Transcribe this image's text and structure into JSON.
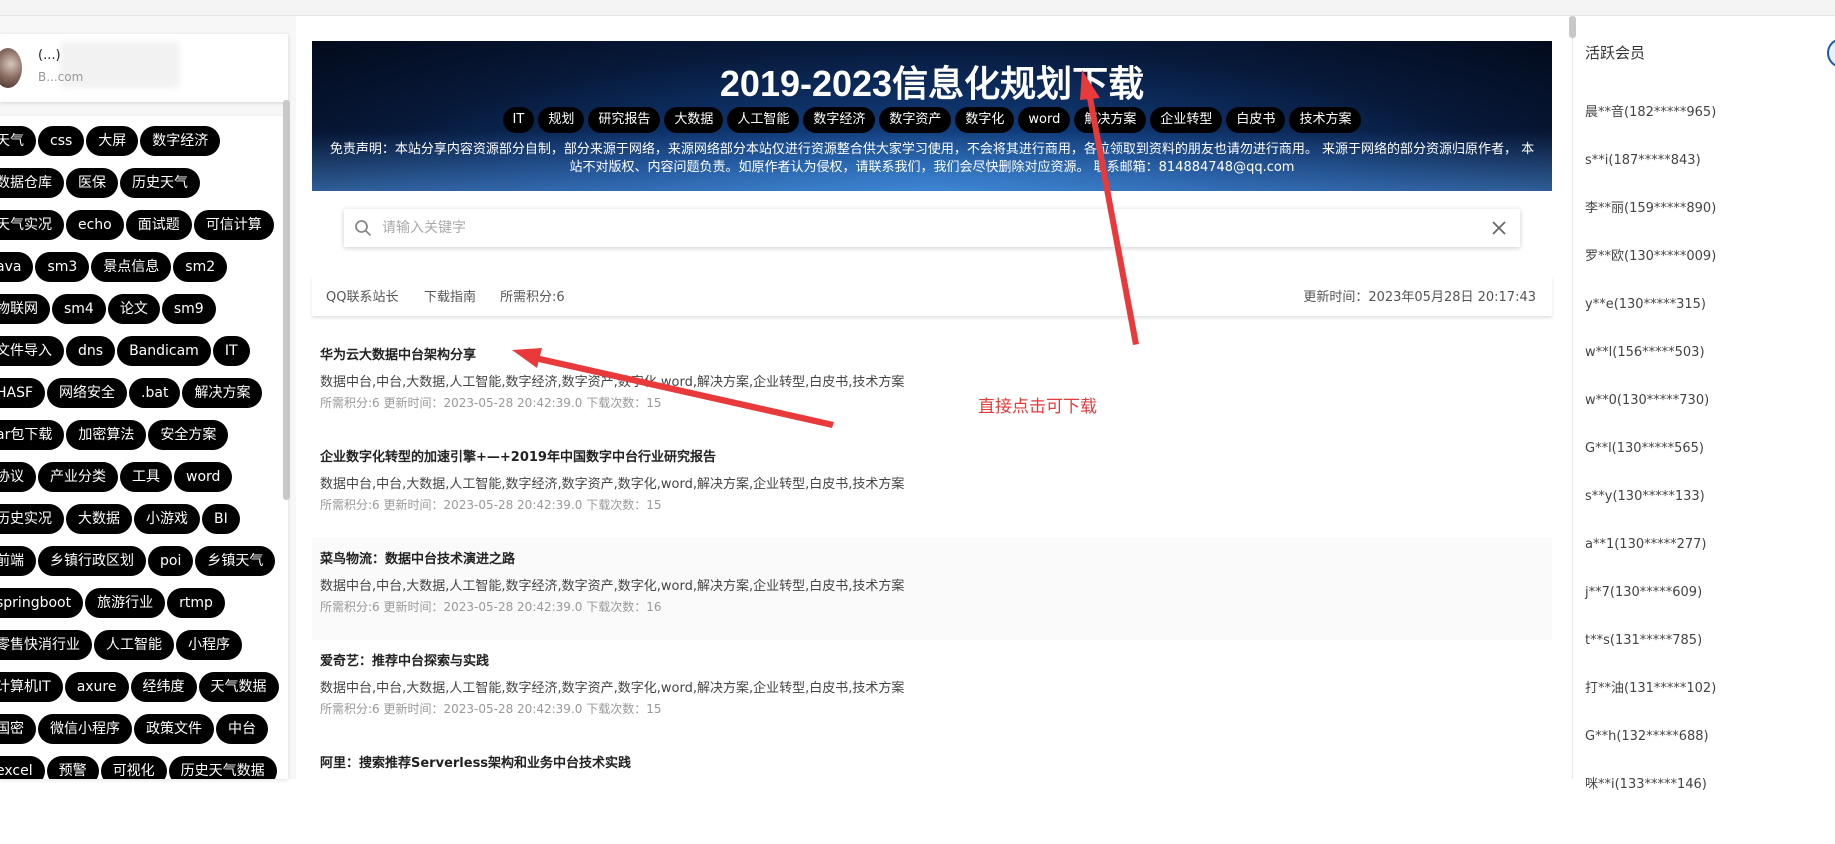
{
  "user": {
    "name": "(...)",
    "sub": "B...com"
  },
  "left_tags": [
    [
      "天气",
      "css",
      "大屏",
      "数字经济"
    ],
    [
      "数据仓库",
      "医保",
      "历史天气"
    ],
    [
      "天气实况",
      "echo",
      "面试题",
      "可信计算"
    ],
    [
      "ava",
      "sm3",
      "景点信息",
      "sm2"
    ],
    [
      "物联网",
      "sm4",
      "论文",
      "sm9"
    ],
    [
      "文件导入",
      "dns",
      "Bandicam",
      "IT"
    ],
    [
      "HASF",
      "网络安全",
      ".bat",
      "解决方案"
    ],
    [
      "ar包下载",
      "加密算法",
      "安全方案"
    ],
    [
      "协议",
      "产业分类",
      "工具",
      "word"
    ],
    [
      "历史实况",
      "大数据",
      "小游戏",
      "BI"
    ],
    [
      "前端",
      "乡镇行政区划",
      "poi",
      "乡镇天气"
    ],
    [
      "springboot",
      "旅游行业",
      "rtmp"
    ],
    [
      "零售快消行业",
      "人工智能",
      "小程序"
    ],
    [
      "计算机IT",
      "axure",
      "经纬度",
      "天气数据"
    ],
    [
      "国密",
      "微信小程序",
      "政策文件",
      "中台"
    ],
    [
      "excel",
      "预警",
      "可视化",
      "历史天气数据"
    ]
  ],
  "banner": {
    "title": "2019-2023信息化规划下载",
    "tags": [
      "IT",
      "规划",
      "研究报告",
      "大数据",
      "人工智能",
      "数字经济",
      "数字资产",
      "数字化",
      "word",
      "解决方案",
      "企业转型",
      "白皮书",
      "技术方案"
    ],
    "disclaimer": "免责声明：本站分享内容资源部分自制，部分来源于网络，来源网络部分本站仅进行资源整合供大家学习使用，不会将其进行商用，各位领取到资料的朋友也请勿进行商用。 来源于网络的部分资源归原作者， 本站不对版权、内容问题负责。如原作者认为侵权，请联系我们，我们会尽快删除对应资源。 联系邮箱：814884748@qq.com"
  },
  "search": {
    "placeholder": "请输入关键字",
    "value": ""
  },
  "infobar": {
    "contact": "QQ联系站长",
    "guide": "下载指南",
    "points": "所需积分:6",
    "updated": "更新时间：2023年05月28日 20:17:43"
  },
  "items": [
    {
      "title": "华为云大数据中台架构分享",
      "tags": "数据中台,中台,大数据,人工智能,数字经济,数字资产,数字化,word,解决方案,企业转型,白皮书,技术方案",
      "meta": "所需积分:6 更新时间：2023-05-28 20:42:39.0 下载次数：15"
    },
    {
      "title": "企业数字化转型的加速引擎+—+2019年中国数字中台行业研究报告",
      "tags": "数据中台,中台,大数据,人工智能,数字经济,数字资产,数字化,word,解决方案,企业转型,白皮书,技术方案",
      "meta": "所需积分:6 更新时间：2023-05-28 20:42:39.0 下载次数：15"
    },
    {
      "title": "菜鸟物流：数据中台技术演进之路",
      "tags": "数据中台,中台,大数据,人工智能,数字经济,数字资产,数字化,word,解决方案,企业转型,白皮书,技术方案",
      "meta": "所需积分:6 更新时间：2023-05-28 20:42:39.0 下载次数：16"
    },
    {
      "title": "爱奇艺：推荐中台探索与实践",
      "tags": "数据中台,中台,大数据,人工智能,数字经济,数字资产,数字化,word,解决方案,企业转型,白皮书,技术方案",
      "meta": "所需积分:6 更新时间：2023-05-28 20:42:39.0 下载次数：15"
    },
    {
      "title": "阿里：搜索推荐Serverless架构和业务中台技术实践",
      "tags": "",
      "meta": ""
    }
  ],
  "annotation": "直接点击可下载",
  "active_members": {
    "title": "活跃会员",
    "list": [
      "晨**音(182*****965)",
      "s**i(187*****843)",
      "李**丽(159*****890)",
      "罗**欧(130*****009)",
      "y**e(130*****315)",
      "w**l(156*****503)",
      "w**0(130*****730)",
      "G**l(130*****565)",
      "s**y(130*****133)",
      "a**1(130*****277)",
      "j**7(130*****609)",
      "t**s(131*****785)",
      "打**油(131*****102)",
      "G**h(132*****688)",
      "咪**i(133*****146)"
    ]
  },
  "colors": {
    "accent_red": "#e83a3a",
    "tag_bg": "#000000"
  }
}
